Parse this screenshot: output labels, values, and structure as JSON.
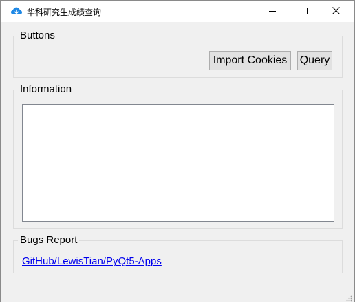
{
  "window": {
    "title": "华科研究生成绩查询",
    "app_icon": "cloud-icon",
    "controls": {
      "minimize": "minimize-icon",
      "maximize": "maximize-icon",
      "close": "close-icon"
    }
  },
  "buttons_group": {
    "title": "Buttons",
    "import_label": "Import Cookies",
    "query_label": "Query"
  },
  "information_group": {
    "title": "Information",
    "text": ""
  },
  "bugs_group": {
    "title": "Bugs Report",
    "link_text": "GitHub/LewisTian/PyQt5-Apps"
  },
  "colors": {
    "window_bg": "#f0f0f0",
    "titlebar_bg": "#ffffff",
    "button_bg": "#e1e1e1",
    "button_border": "#adadad",
    "link": "#0000ee",
    "icon_blue": "#1e88e5"
  }
}
